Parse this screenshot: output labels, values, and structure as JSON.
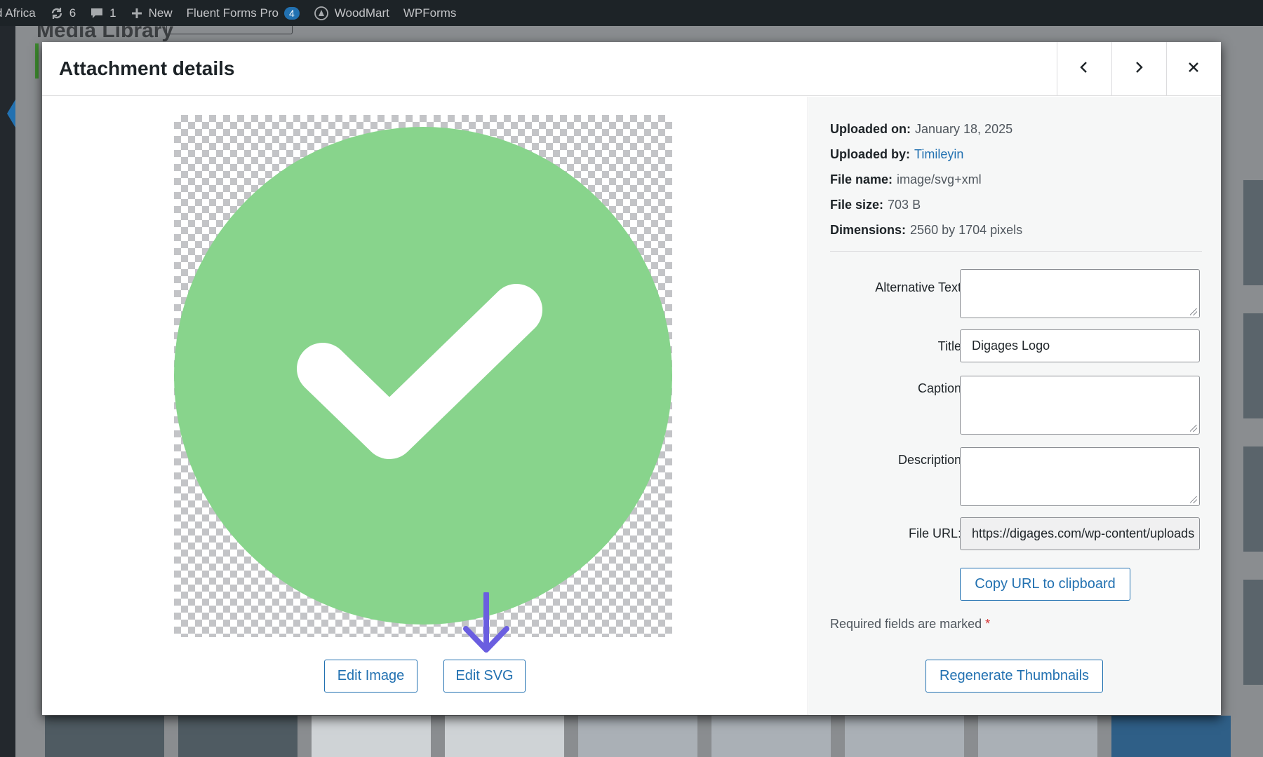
{
  "admin_bar": {
    "site_name": "d Africa",
    "updates_count": "6",
    "comments_count": "1",
    "new_label": "New",
    "fluent_forms_label": "Fluent Forms Pro",
    "fluent_forms_badge": "4",
    "woodmart_label": "WoodMart",
    "wpforms_label": "WPForms"
  },
  "background": {
    "page_title": "Media Library"
  },
  "modal": {
    "title": "Attachment details",
    "prev_icon": "chevron-left-icon",
    "next_icon": "chevron-right-icon",
    "close_icon": "close-icon"
  },
  "preview": {
    "circle_color": "#88d48c",
    "check_color": "#ffffff",
    "arrow_color": "#6a5ee0",
    "edit_image_label": "Edit Image",
    "edit_svg_label": "Edit SVG"
  },
  "details": {
    "uploaded_on_label": "Uploaded on:",
    "uploaded_on": "January 18, 2025",
    "uploaded_by_label": "Uploaded by:",
    "uploaded_by": "Timileyin",
    "file_name_label": "File name:",
    "file_name": "image/svg+xml",
    "file_size_label": "File size:",
    "file_size": "703 B",
    "dimensions_label": "Dimensions:",
    "dimensions": "2560 by 1704 pixels"
  },
  "form": {
    "alt_text_label": "Alternative Text",
    "alt_text_value": "",
    "title_label": "Title",
    "title_value": "Digages Logo",
    "caption_label": "Caption",
    "caption_value": "",
    "description_label": "Description",
    "description_value": "",
    "file_url_label": "File URL:",
    "file_url_value": "https://digages.com/wp-content/uploads",
    "copy_url_label": "Copy URL to clipboard",
    "required_text": "Required fields are marked",
    "required_star": "*",
    "regenerate_label": "Regenerate Thumbnails"
  },
  "colors": {
    "accent": "#2271b1",
    "admin_bar_bg": "#1d2327"
  }
}
